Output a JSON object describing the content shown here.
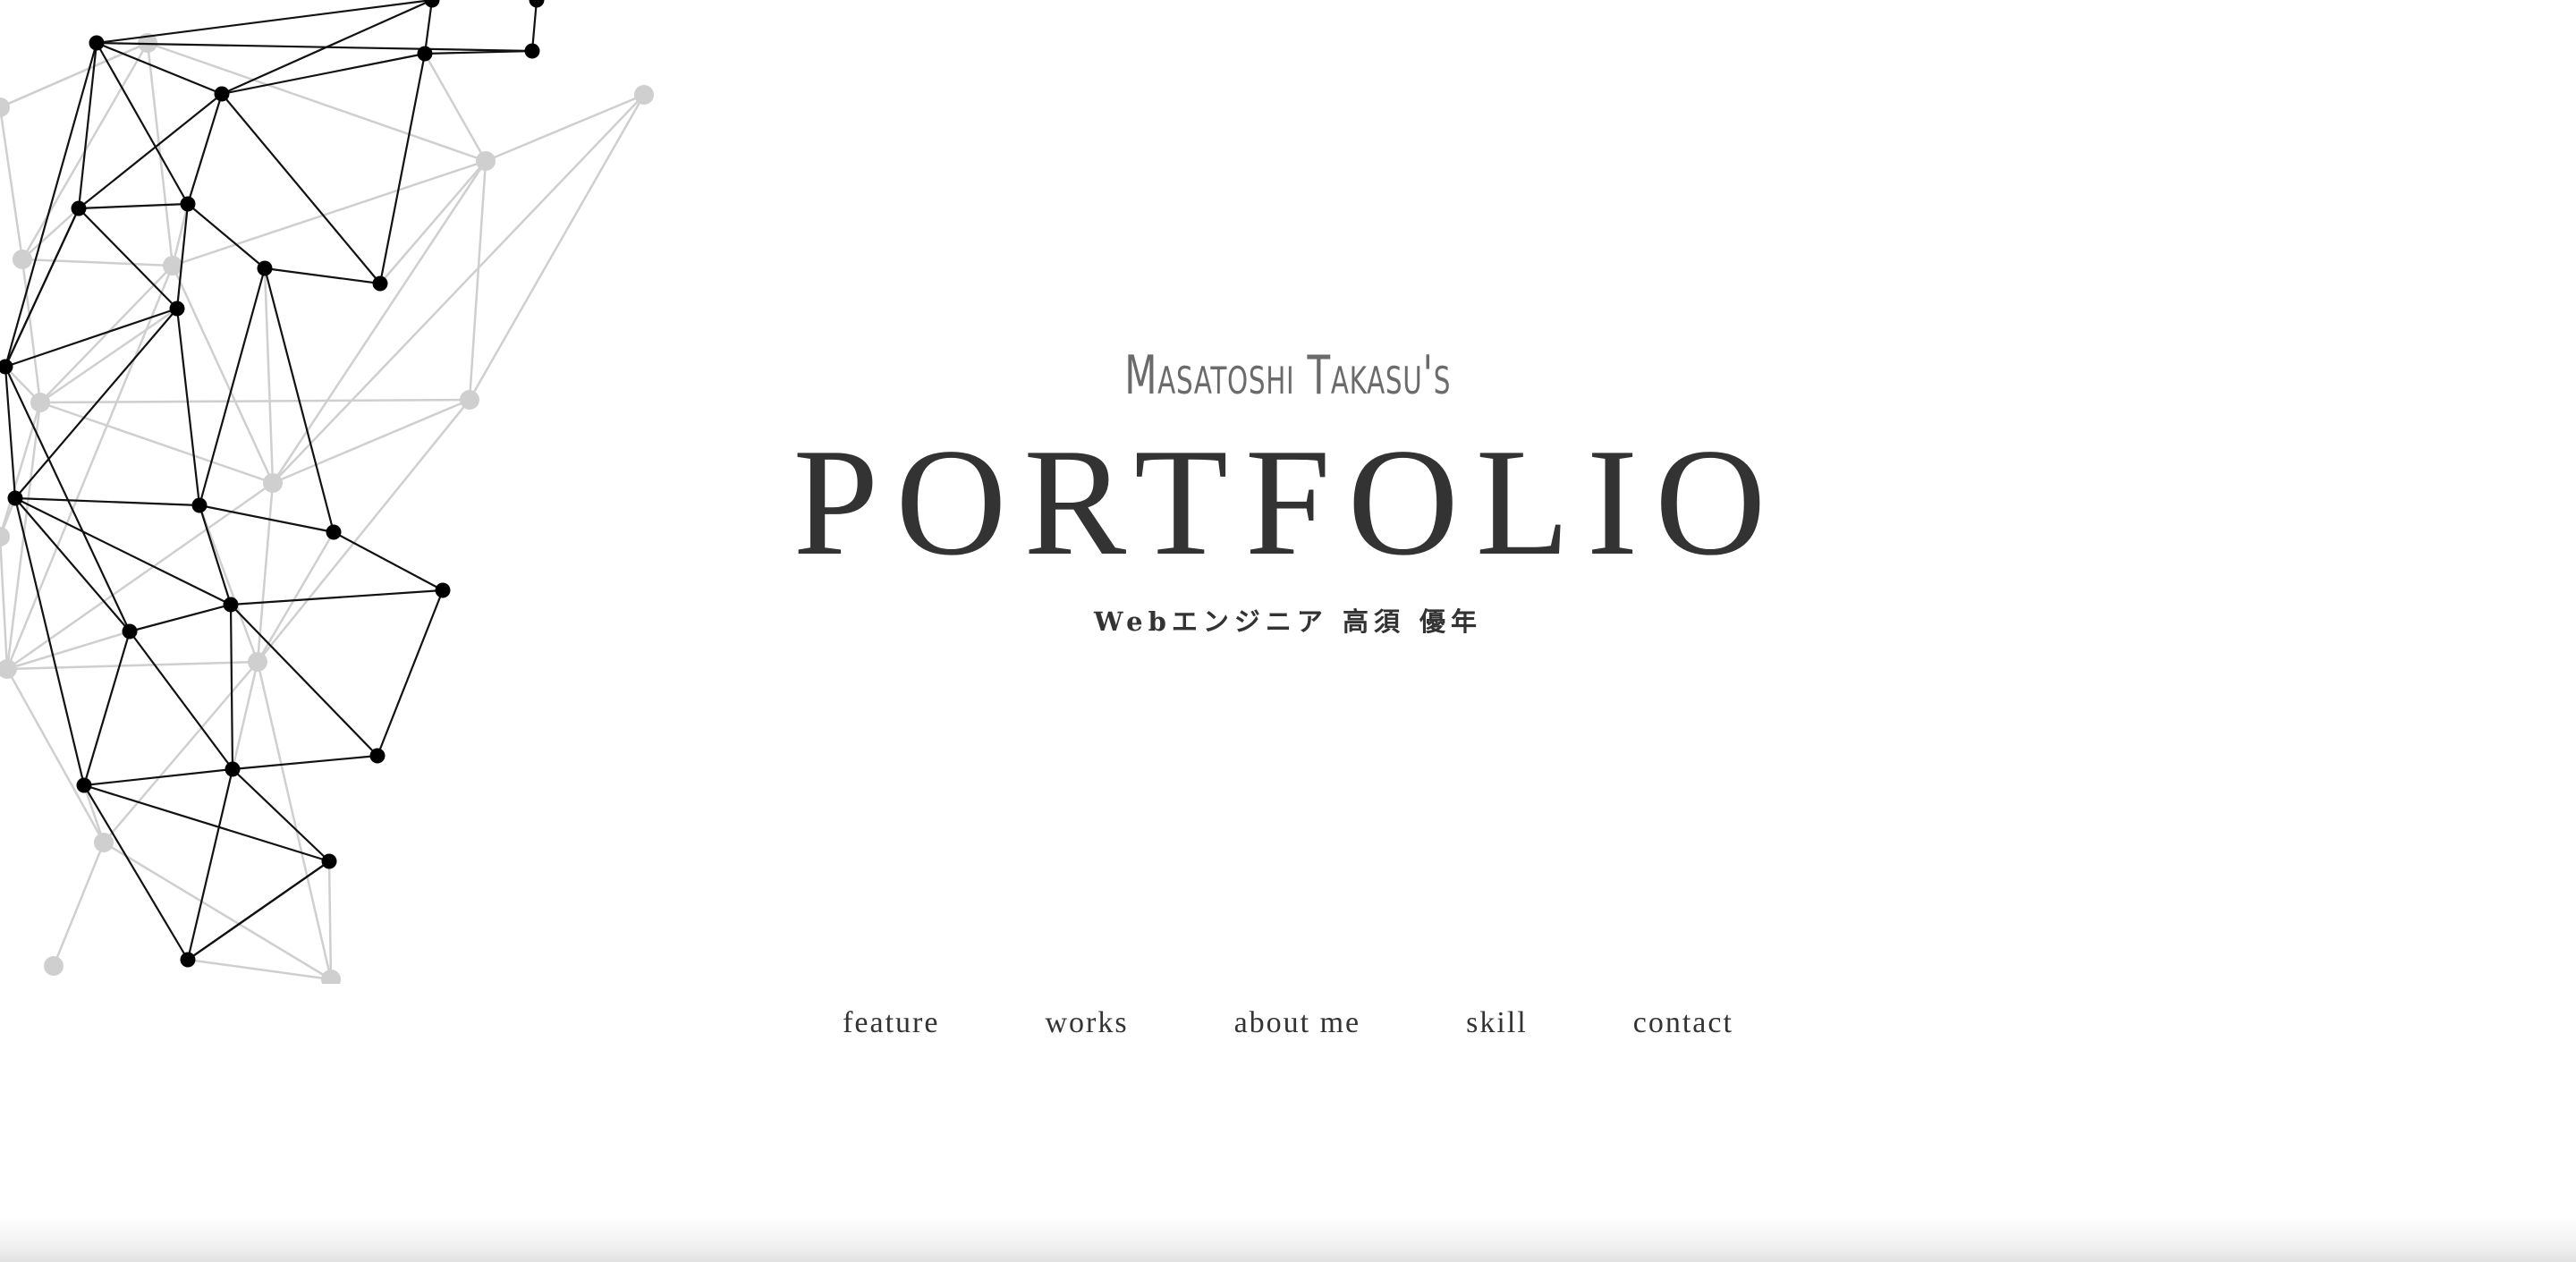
{
  "hero": {
    "subtitle": "Masatoshi Takasu's",
    "title": "PORTFOLIO",
    "tagline": "Webエンジニア 高須 優年"
  },
  "nav": {
    "items": [
      {
        "label": "feature"
      },
      {
        "label": "works"
      },
      {
        "label": "about me"
      },
      {
        "label": "skill"
      },
      {
        "label": "contact"
      }
    ]
  },
  "colors": {
    "text": "#333333",
    "subtitle": "#6b6b6b",
    "network_dark": "#000000",
    "network_light": "#cccccc",
    "background": "#ffffff"
  }
}
